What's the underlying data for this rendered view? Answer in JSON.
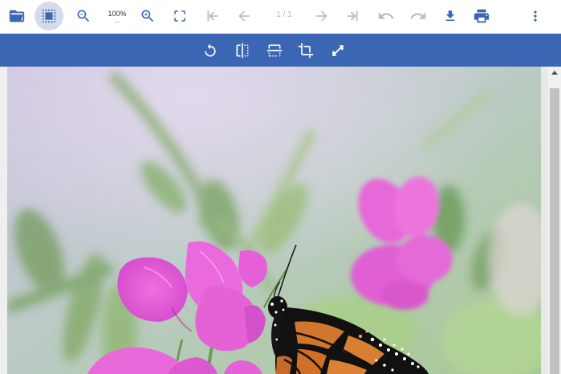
{
  "toolbar": {
    "zoom_label": "100%",
    "zoom_dots": "...",
    "page_indicator": "1 / 1"
  },
  "colors": {
    "accent": "#3b66b3",
    "icon": "#3b66b3",
    "icon_disabled": "#bdbdbd",
    "selected_bg": "#d5dbe9"
  },
  "icons": {
    "toolbar": [
      "folder-open-icon",
      "selection-icon",
      "zoom-out-icon",
      "zoom-in-icon",
      "fit-screen-icon",
      "first-page-icon",
      "previous-page-icon",
      "next-page-icon",
      "last-page-icon",
      "undo-icon",
      "redo-icon",
      "download-icon",
      "print-icon",
      "more-vert-icon"
    ],
    "image_tools": [
      "rotate-icon",
      "flip-horizontal-icon",
      "flip-vertical-icon",
      "crop-icon",
      "resize-icon"
    ]
  }
}
